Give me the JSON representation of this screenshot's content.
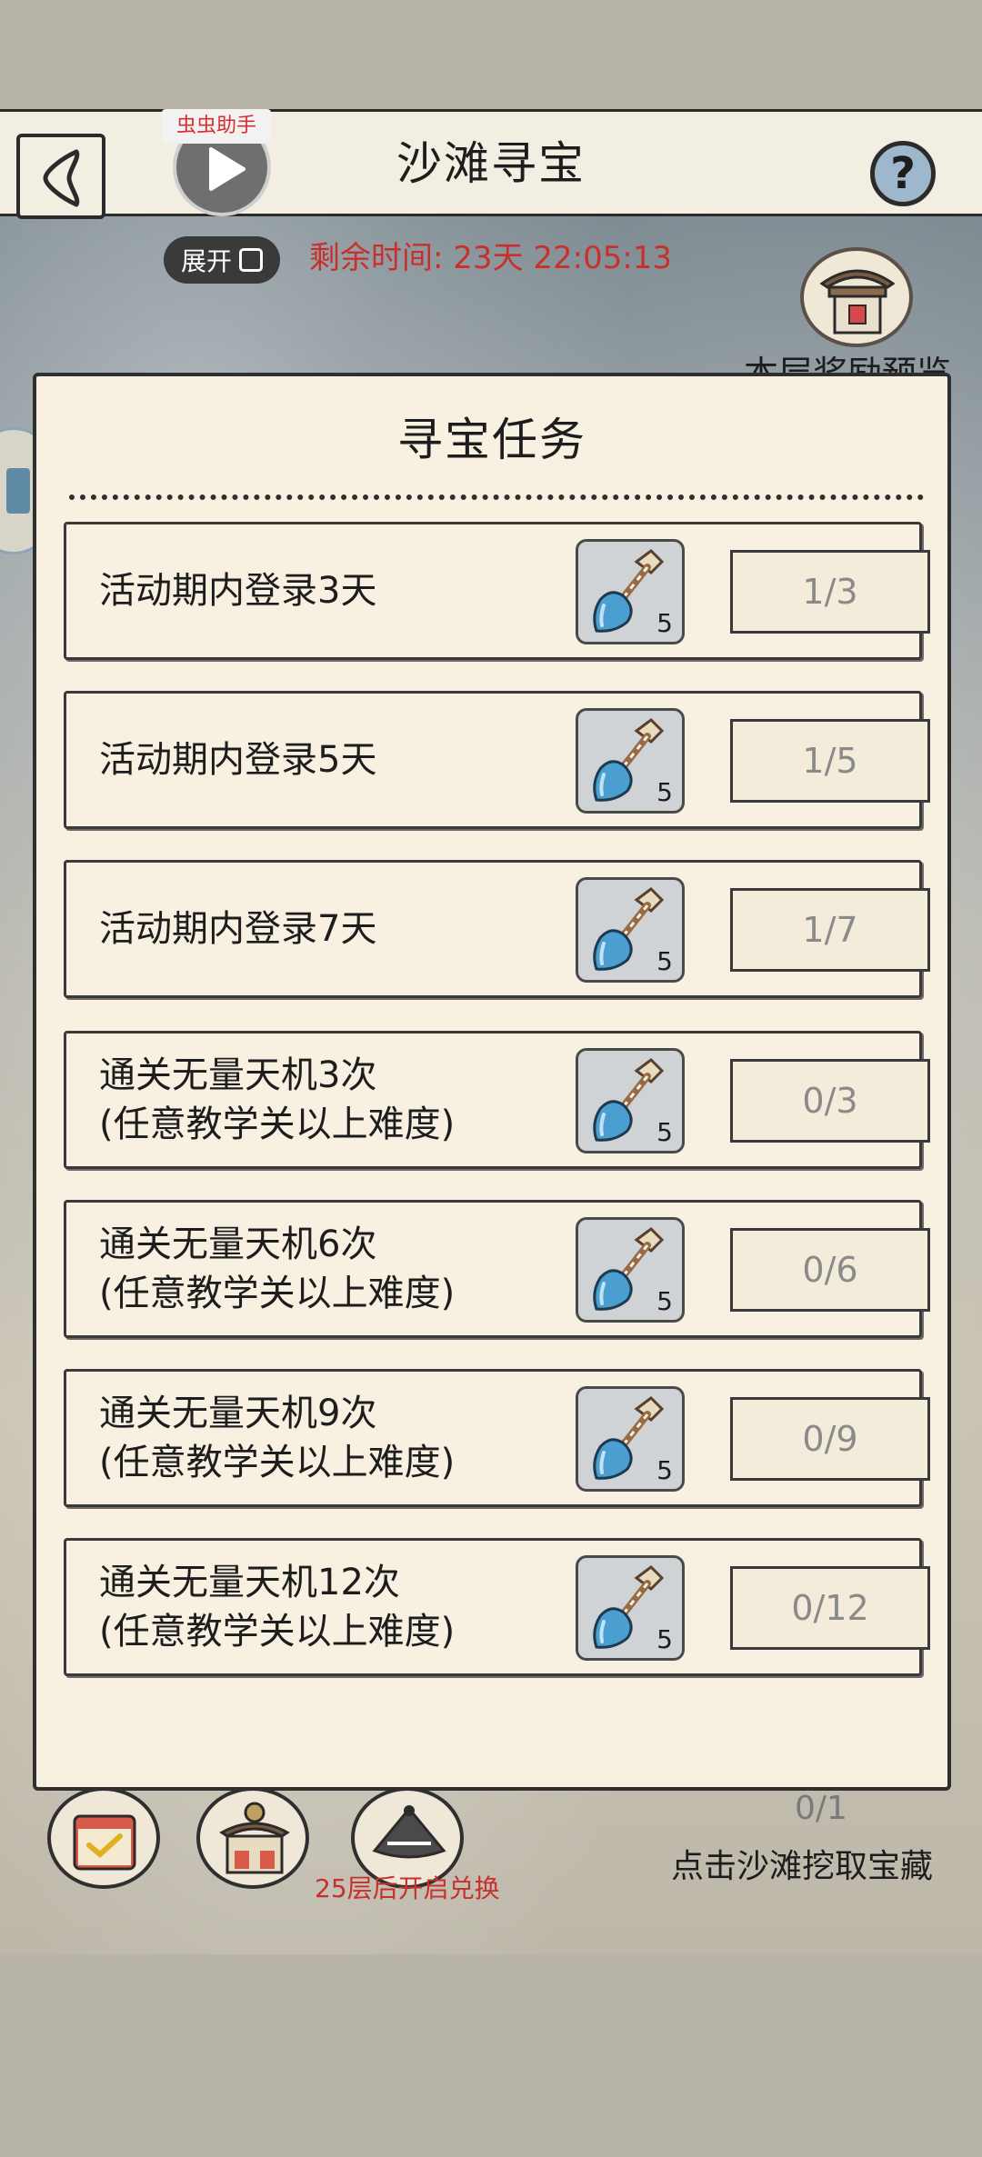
{
  "header": {
    "title": "沙滩寻宝",
    "assistant_tag": "虫虫助手",
    "expand_label": "展开",
    "timer_label": "剩余时间:",
    "timer_value": "23天 22:05:13",
    "reward_preview_label": "本层奖励预览",
    "help_symbol": "?"
  },
  "modal": {
    "title": "寻宝任务",
    "tasks": [
      {
        "line1": "活动期内登录3天",
        "line2": "",
        "reward_count": "5",
        "progress": "1/3"
      },
      {
        "line1": "活动期内登录5天",
        "line2": "",
        "reward_count": "5",
        "progress": "1/5"
      },
      {
        "line1": "活动期内登录7天",
        "line2": "",
        "reward_count": "5",
        "progress": "1/7"
      },
      {
        "line1": "通关无量天机3次",
        "line2": "(任意教学关以上难度)",
        "reward_count": "5",
        "progress": "0/3"
      },
      {
        "line1": "通关无量天机6次",
        "line2": "(任意教学关以上难度)",
        "reward_count": "5",
        "progress": "0/6"
      },
      {
        "line1": "通关无量天机9次",
        "line2": "(任意教学关以上难度)",
        "reward_count": "5",
        "progress": "0/9"
      },
      {
        "line1": "通关无量天机12次",
        "line2": "(任意教学关以上难度)",
        "reward_count": "5",
        "progress": "0/12"
      }
    ]
  },
  "bottom": {
    "unlock_text": "25层后开启兑换",
    "dig_progress": "0/1",
    "dig_label": "点击沙滩挖取宝藏"
  },
  "icons": {
    "back": "back-arrow-icon",
    "play": "play-icon",
    "help": "question-icon",
    "reward_preview": "gate-icon",
    "shovel": "shovel-icon",
    "calendar": "calendar-check-icon",
    "shop": "shop-icon",
    "hat": "bamboo-hat-icon"
  },
  "colors": {
    "paper": "#f8f1e1",
    "ink": "#2f2f2f",
    "timer_red": "#c8302c",
    "shovel_blue": "#4a9fd0"
  }
}
